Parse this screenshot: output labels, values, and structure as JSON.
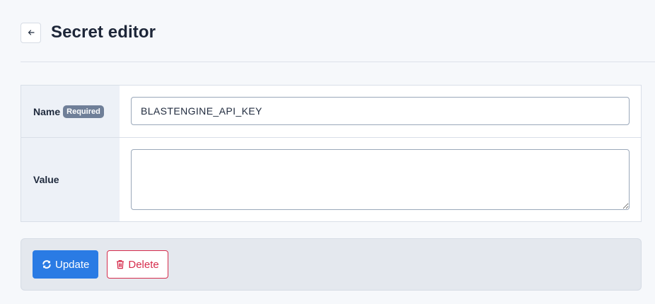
{
  "page": {
    "title": "Secret editor",
    "back_icon": "arrow-left-icon"
  },
  "form": {
    "name": {
      "label": "Name",
      "badge": "Required",
      "value": "BLASTENGINE_API_KEY"
    },
    "value": {
      "label": "Value",
      "value": ""
    }
  },
  "actions": {
    "update_label": "Update",
    "update_icon": "refresh-icon",
    "delete_label": "Delete",
    "delete_icon": "trash-icon"
  },
  "colors": {
    "primary": "#2a7be4",
    "danger": "#d62c4c",
    "badge": "#6f7f98",
    "label_bg": "#edf1f7"
  }
}
